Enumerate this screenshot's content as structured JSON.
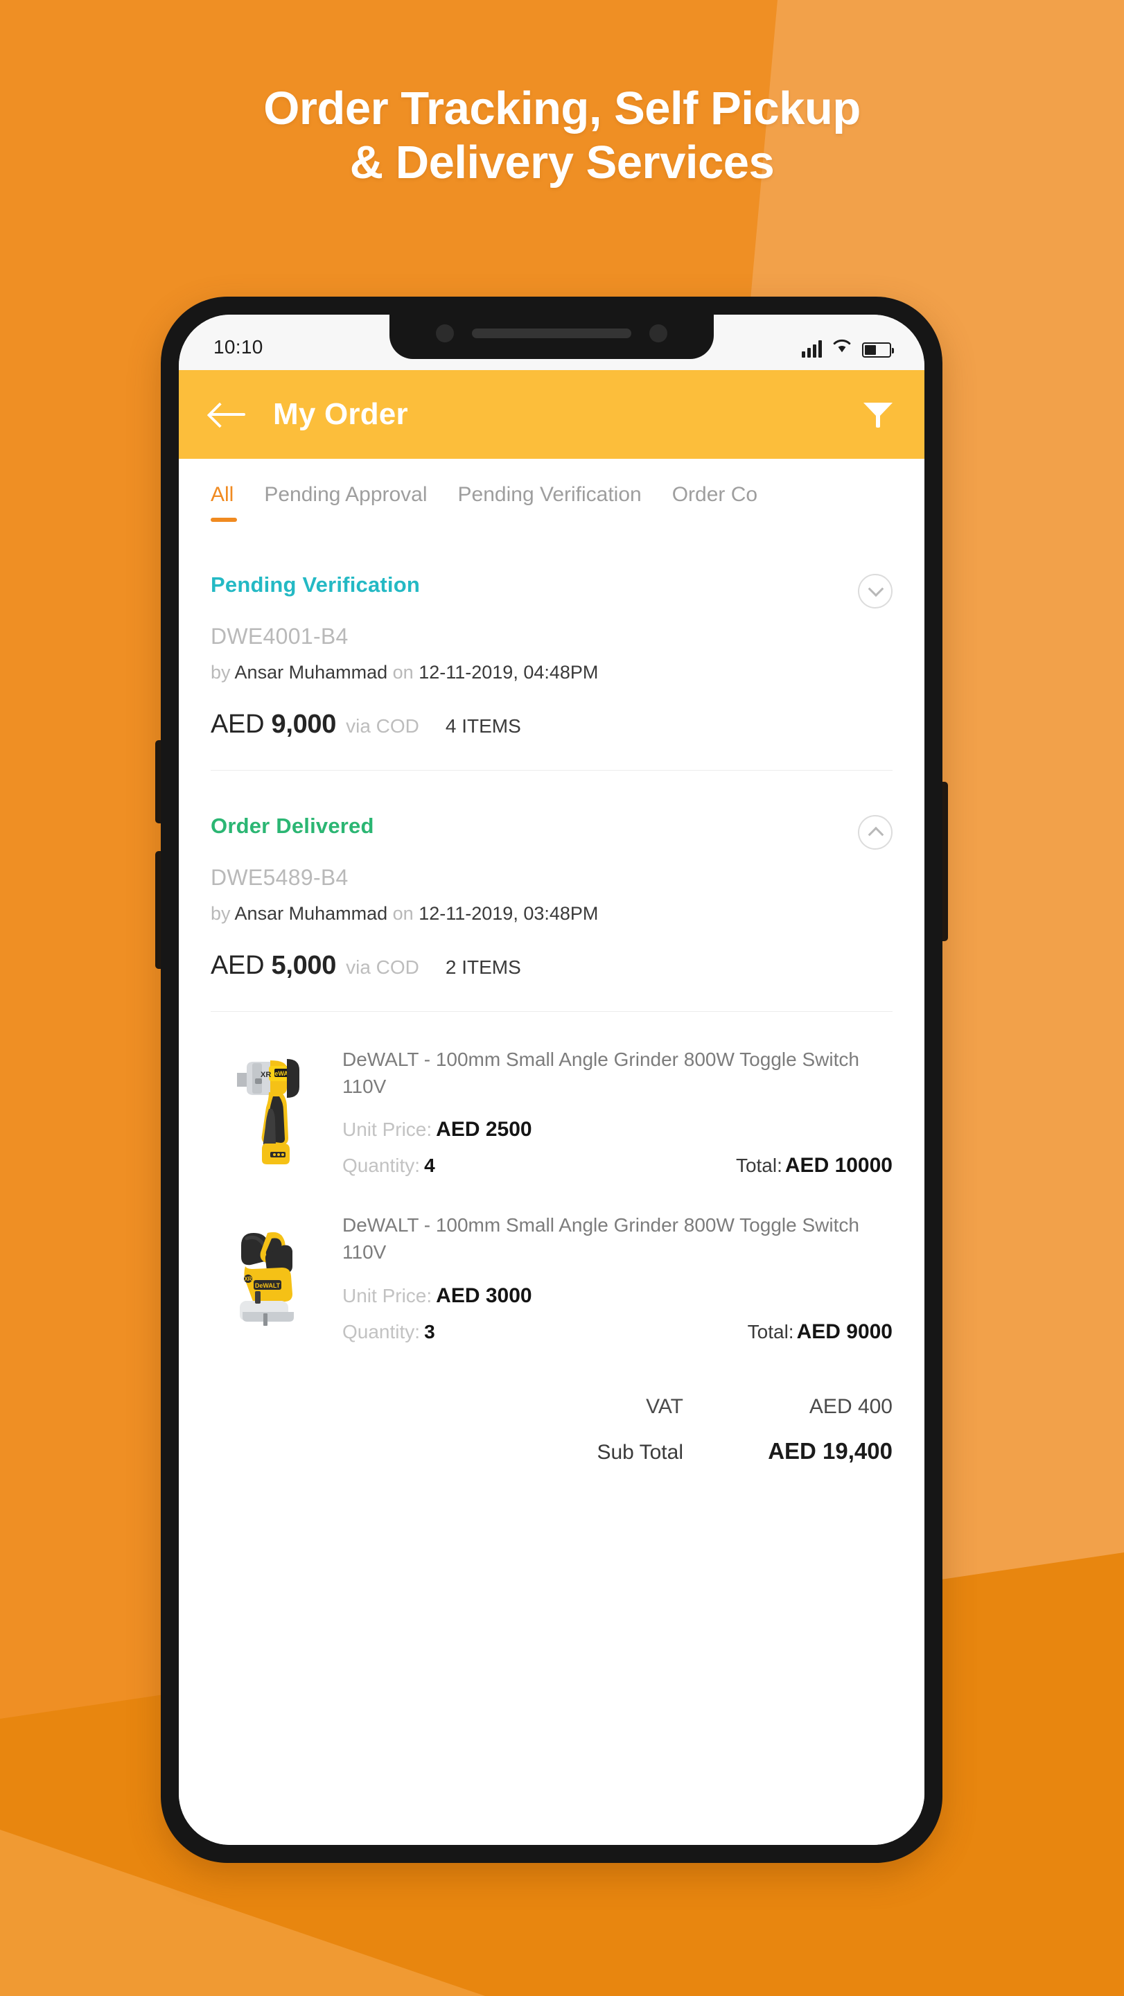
{
  "promo": {
    "headline_line1": "Order Tracking, Self Pickup",
    "headline_line2": "& Delivery Services",
    "bg_color": "#ef8f24",
    "accent_color": "#fcbe3b"
  },
  "phone": {
    "status_bar": {
      "time": "10:10",
      "signal_icon": "signal-bars-icon",
      "wifi_icon": "wifi-icon",
      "battery_icon": "battery-icon"
    },
    "app_bar": {
      "back_icon": "back-arrow-icon",
      "title": "My Order",
      "filter_icon": "filter-icon"
    },
    "tabs": [
      {
        "label": "All",
        "active": true
      },
      {
        "label": "Pending Approval",
        "active": false
      },
      {
        "label": "Pending Verification",
        "active": false
      },
      {
        "label": "Order Co",
        "active": false
      }
    ],
    "orders": [
      {
        "status": "Pending Verification",
        "status_color": "#24b9c4",
        "code": "DWE4001-B4",
        "by_label": "by",
        "customer": "Ansar Muhammad",
        "on_label": "on",
        "datetime": "12-11-2019, 04:48PM",
        "currency": "AED",
        "amount": "9,000",
        "payment": "via COD",
        "items_count": "4 ITEMS",
        "expanded": false,
        "chevron": "chevron-down-icon"
      },
      {
        "status": "Order Delivered",
        "status_color": "#2bb673",
        "code": "DWE5489-B4",
        "by_label": "by",
        "customer": "Ansar Muhammad",
        "on_label": "on",
        "datetime": "12-11-2019, 03:48PM",
        "currency": "AED",
        "amount": "5,000",
        "payment": "via COD",
        "items_count": "2 ITEMS",
        "expanded": true,
        "chevron": "chevron-up-icon"
      }
    ],
    "products": [
      {
        "title": "DeWALT - 100mm Small  Angle Grinder 800W Toggle Switch 110V",
        "unit_price_label": "Unit Price:",
        "unit_price": "AED 2500",
        "quantity_label": "Quantity:",
        "quantity": "4",
        "total_label": "Total:",
        "total": "AED 10000",
        "image": "dewalt-impact-wrench"
      },
      {
        "title": "DeWALT - 100mm Small  Angle Grinder 800W Toggle Switch 110V",
        "unit_price_label": "Unit Price:",
        "unit_price": "AED 3000",
        "quantity_label": "Quantity:",
        "quantity": "3",
        "total_label": "Total:",
        "total": "AED 9000",
        "image": "dewalt-jigsaw"
      }
    ],
    "totals": [
      {
        "label": "VAT",
        "value": "AED 400"
      },
      {
        "label": "Sub Total",
        "value": "AED 19,400"
      }
    ]
  }
}
